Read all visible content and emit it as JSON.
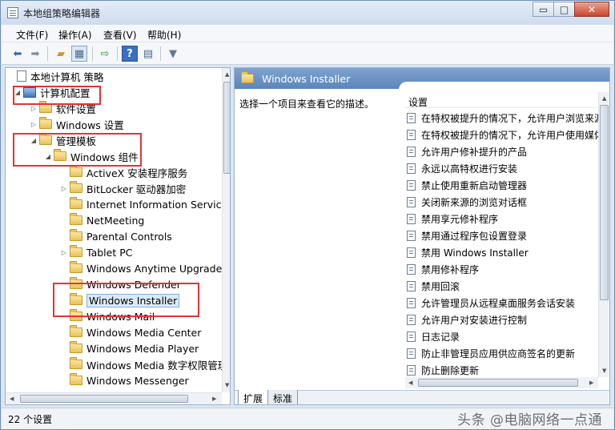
{
  "window": {
    "title": "本地组策略编辑器",
    "controls": {
      "minimize": "▭",
      "maximize": "□",
      "close": "✕"
    }
  },
  "menu": [
    {
      "label": "文件(F)"
    },
    {
      "label": "操作(A)"
    },
    {
      "label": "查看(V)"
    },
    {
      "label": "帮助(H)"
    }
  ],
  "toolbar": {
    "icons": [
      "back-arrow-icon",
      "forward-arrow-icon",
      "up-folder-icon",
      "show-hide-tree-icon",
      "export-list-icon",
      "help-icon",
      "properties-icon",
      "filter-icon"
    ]
  },
  "tree": {
    "items": [
      {
        "label": "本地计算机 策略",
        "icon": "doc",
        "level": 0,
        "expander": ""
      },
      {
        "label": "计算机配置",
        "icon": "computer",
        "level": 0,
        "expander": "◢"
      },
      {
        "label": "软件设置",
        "icon": "folder",
        "level": 1,
        "expander": "▷"
      },
      {
        "label": "Windows 设置",
        "icon": "folder",
        "level": 1,
        "expander": "▷"
      },
      {
        "label": "管理模板",
        "icon": "folder",
        "level": 1,
        "expander": "◢"
      },
      {
        "label": "Windows 组件",
        "icon": "folder",
        "level": 2,
        "expander": "◢"
      },
      {
        "label": "ActiveX 安装程序服务",
        "icon": "folder",
        "level": 3,
        "expander": ""
      },
      {
        "label": "BitLocker 驱动器加密",
        "icon": "folder",
        "level": 3,
        "expander": "▷"
      },
      {
        "label": "Internet Information Services",
        "icon": "folder",
        "level": 3,
        "expander": ""
      },
      {
        "label": "NetMeeting",
        "icon": "folder",
        "level": 3,
        "expander": ""
      },
      {
        "label": "Parental Controls",
        "icon": "folder",
        "level": 3,
        "expander": ""
      },
      {
        "label": "Tablet PC",
        "icon": "folder",
        "level": 3,
        "expander": "▷"
      },
      {
        "label": "Windows Anytime Upgrade",
        "icon": "folder",
        "level": 3,
        "expander": ""
      },
      {
        "label": "Windows Defender",
        "icon": "folder",
        "level": 3,
        "expander": ""
      },
      {
        "label": "Windows Installer",
        "icon": "folder",
        "level": 3,
        "expander": "",
        "selected": true
      },
      {
        "label": "Windows Mail",
        "icon": "folder",
        "level": 3,
        "expander": ""
      },
      {
        "label": "Windows Media Center",
        "icon": "folder",
        "level": 3,
        "expander": ""
      },
      {
        "label": "Windows Media Player",
        "icon": "folder",
        "level": 3,
        "expander": ""
      },
      {
        "label": "Windows Media 数字权限管理",
        "icon": "folder",
        "level": 3,
        "expander": ""
      },
      {
        "label": "Windows Messenger",
        "icon": "folder",
        "level": 3,
        "expander": ""
      }
    ]
  },
  "right": {
    "header_title": "Windows Installer",
    "description": "选择一个项目来查看它的描述。",
    "list_header": "设置",
    "settings": [
      "在特权被提升的情况下，允许用户浏览来源",
      "在特权被提升的情况下，允许用户使用媒体",
      "允许用户修补提升的产品",
      "永远以高特权进行安装",
      "禁止使用重新启动管理器",
      "关闭新来源的浏览对话框",
      "禁用享元修补程序",
      "禁用通过程序包设置登录",
      "禁用 Windows Installer",
      "禁用修补程序",
      "禁用回滚",
      "允许管理员从远程桌面服务会话安装",
      "允许用户对安装进行控制",
      "日志记录",
      "防止非管理员应用供应商签名的更新",
      "防止删除更新"
    ],
    "tabs": [
      {
        "label": "扩展"
      },
      {
        "label": "标准"
      }
    ]
  },
  "status": {
    "text": "22 个设置",
    "watermark": "头条 @电脑网络一点通"
  }
}
